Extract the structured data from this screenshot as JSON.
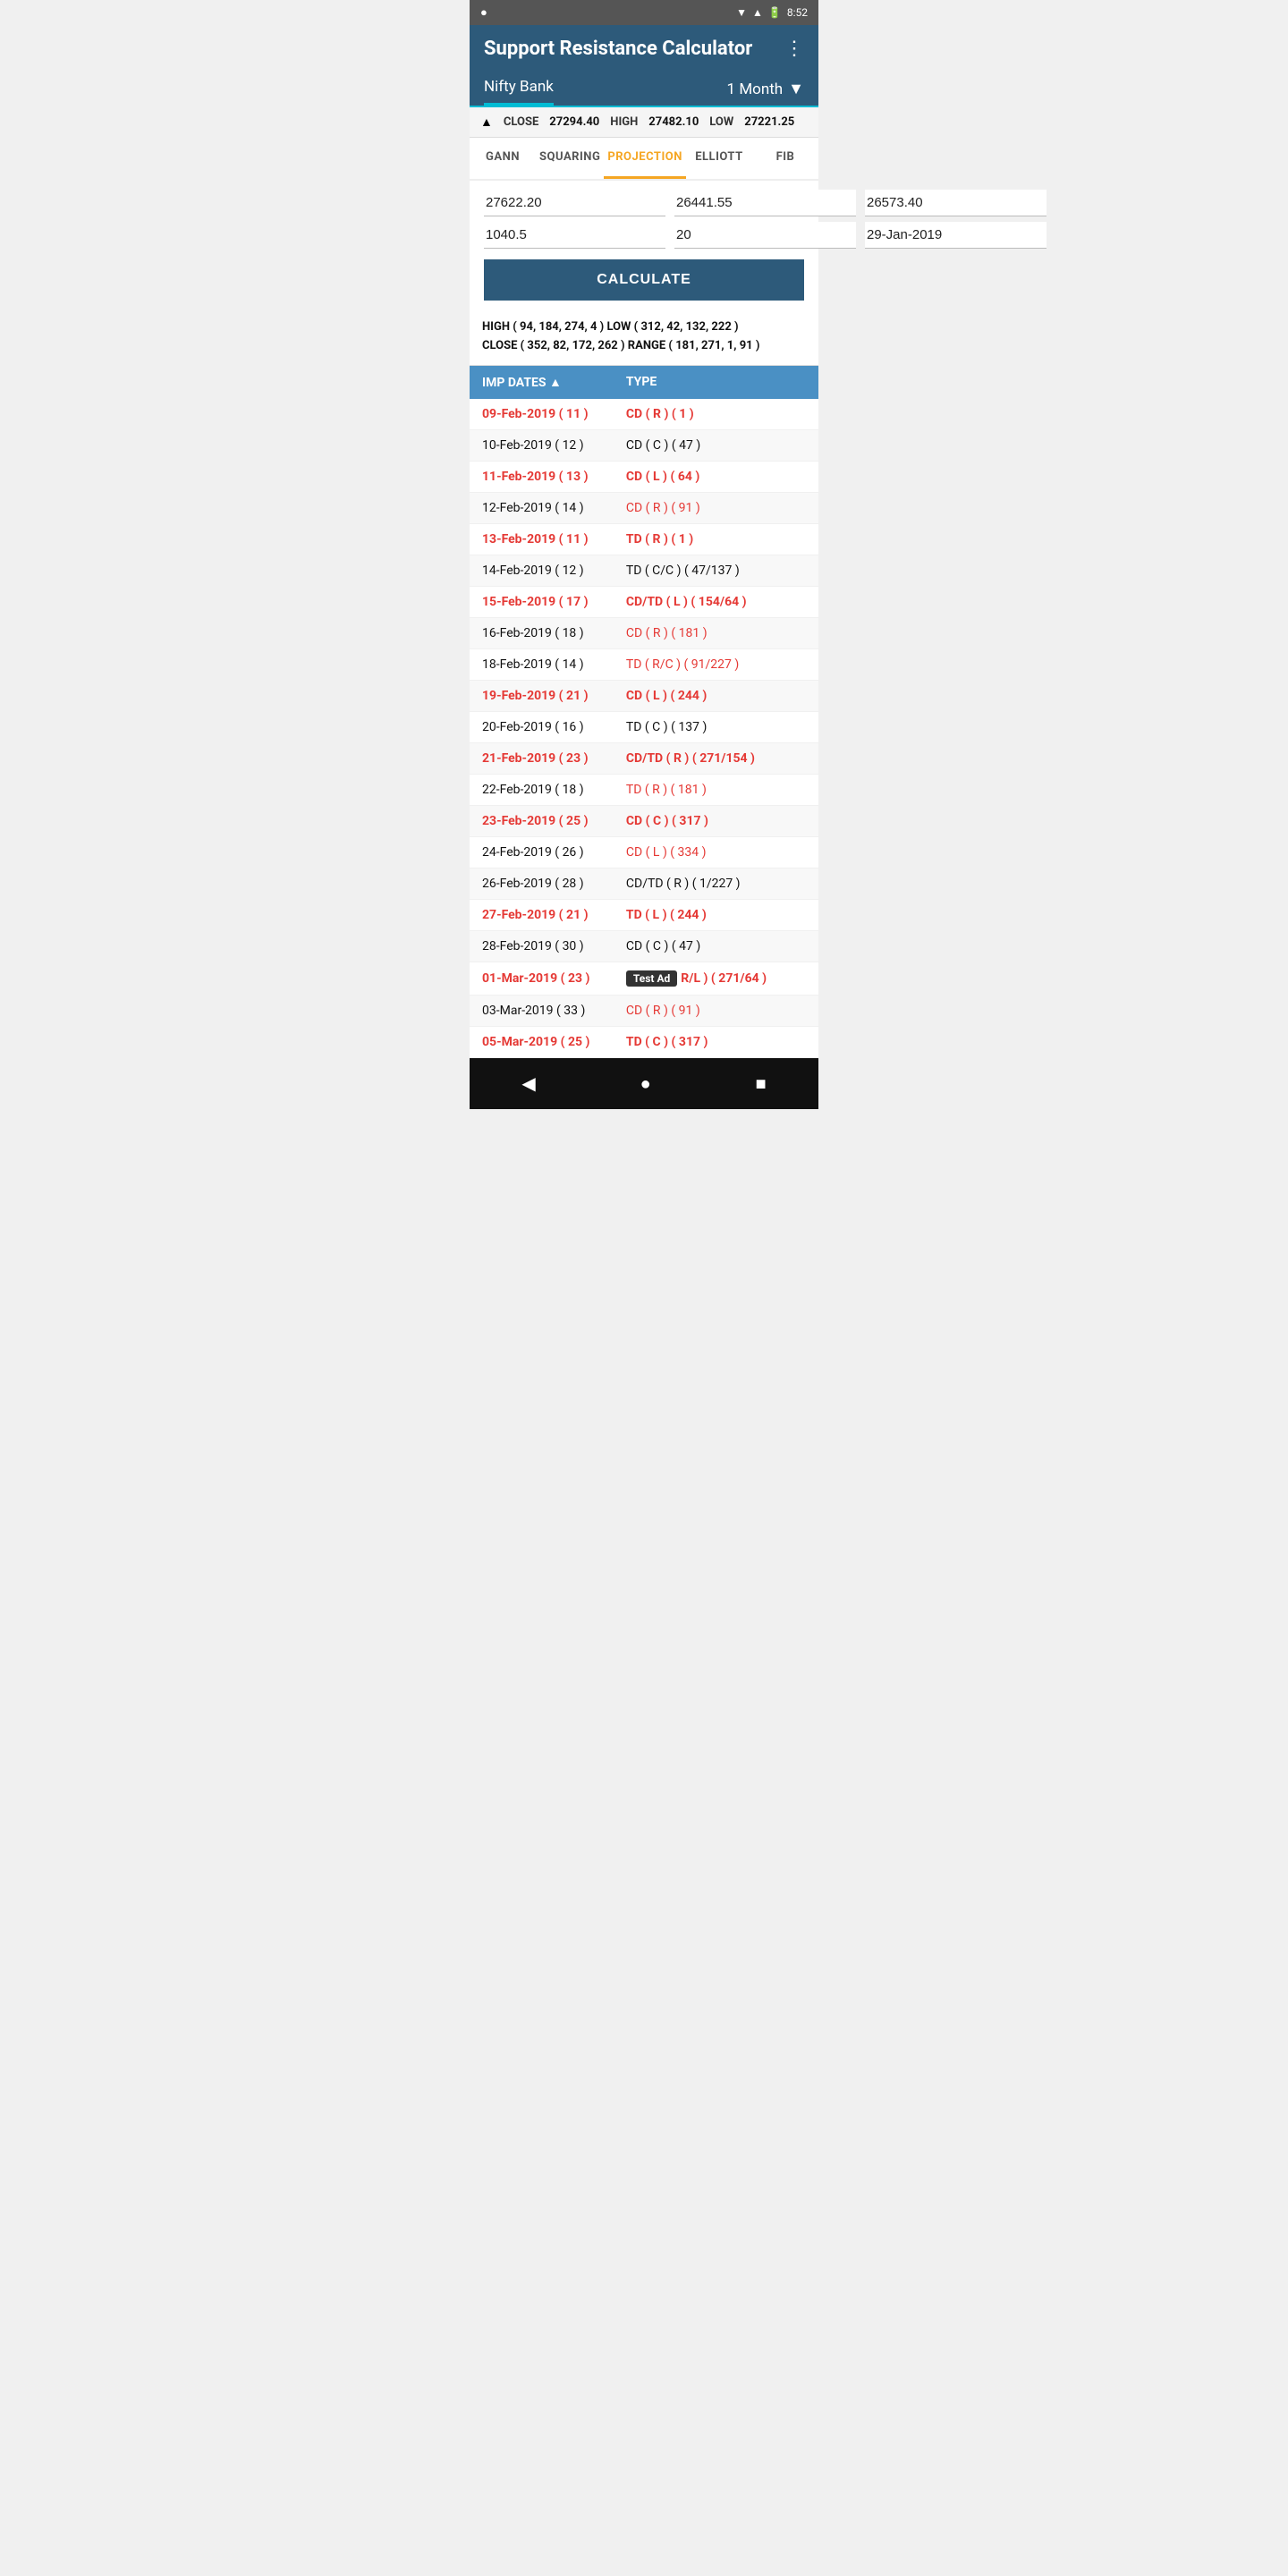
{
  "statusBar": {
    "leftIcon": "●",
    "time": "8:52",
    "icons": [
      "wifi",
      "signal",
      "battery"
    ]
  },
  "header": {
    "title": "Support Resistance Calculator",
    "menuIcon": "⋮"
  },
  "toolbar": {
    "stockName": "Nifty Bank",
    "period": "1 Month",
    "dropdownArrow": "▼"
  },
  "priceBar": {
    "arrow": "▲",
    "closeLabel": "CLOSE",
    "closeValue": "27294.40",
    "highLabel": "HIGH",
    "highValue": "27482.10",
    "lowLabel": "LOW",
    "lowValue": "27221.25"
  },
  "tabs": [
    {
      "id": "gann",
      "label": "GANN",
      "active": false
    },
    {
      "id": "squaring",
      "label": "SQUARING",
      "active": false
    },
    {
      "id": "projection",
      "label": "PROJECTION",
      "active": true
    },
    {
      "id": "elliott",
      "label": "ELLIOTT",
      "active": false
    },
    {
      "id": "fib",
      "label": "FIB",
      "active": false
    }
  ],
  "inputs": {
    "row1": [
      "27622.20",
      "26441.55",
      "26573.40"
    ],
    "row2": [
      "1040.5",
      "20",
      "29-Jan-2019"
    ]
  },
  "calculateLabel": "CALCULATE",
  "resultsHeader": {
    "line1": "HIGH ( 94, 184, 274, 4 )    LOW ( 312, 42, 132, 222 )",
    "line2": "CLOSE ( 352, 82, 172, 262 )  RANGE ( 181, 271, 1, 91 )"
  },
  "tableHeader": {
    "col1": "IMP DATES ▲",
    "col2": "TYPE"
  },
  "tableRows": [
    {
      "date": "09-Feb-2019 ( 11 )",
      "type": "CD ( R ) ( 1 )",
      "red": true
    },
    {
      "date": "10-Feb-2019 ( 12 )",
      "type": "CD ( C ) ( 47 )",
      "red": false
    },
    {
      "date": "11-Feb-2019 ( 13 )",
      "type": "CD ( L ) ( 64 )",
      "red": true
    },
    {
      "date": "12-Feb-2019 ( 14 )",
      "type": "CD ( R ) ( 91 )",
      "red": false,
      "typeRed": true
    },
    {
      "date": "13-Feb-2019 ( 11 )",
      "type": "TD ( R ) ( 1 )",
      "red": true
    },
    {
      "date": "14-Feb-2019 ( 12 )",
      "type": "TD ( C/C ) ( 47/137 )",
      "red": false
    },
    {
      "date": "15-Feb-2019 ( 17 )",
      "type": "CD/TD ( L ) ( 154/64 )",
      "red": true
    },
    {
      "date": "16-Feb-2019 ( 18 )",
      "type": "CD ( R ) ( 181 )",
      "red": false,
      "typeRed": true
    },
    {
      "date": "18-Feb-2019 ( 14 )",
      "type": "TD ( R/C ) ( 91/227 )",
      "red": false,
      "typeRed": true
    },
    {
      "date": "19-Feb-2019 ( 21 )",
      "type": "CD ( L ) ( 244 )",
      "red": true
    },
    {
      "date": "20-Feb-2019 ( 16 )",
      "type": "TD ( C ) ( 137 )",
      "red": false
    },
    {
      "date": "21-Feb-2019 ( 23 )",
      "type": "CD/TD ( R ) ( 271/154 )",
      "red": true
    },
    {
      "date": "22-Feb-2019 ( 18 )",
      "type": "TD ( R ) ( 181 )",
      "red": false,
      "typeRed": true
    },
    {
      "date": "23-Feb-2019 ( 25 )",
      "type": "CD ( C ) ( 317 )",
      "red": true
    },
    {
      "date": "24-Feb-2019 ( 26 )",
      "type": "CD ( L ) ( 334 )",
      "red": false,
      "typeRed": true
    },
    {
      "date": "26-Feb-2019 ( 28 )",
      "type": "CD/TD ( R ) ( 1/227 )",
      "red": false
    },
    {
      "date": "27-Feb-2019 ( 21 )",
      "type": "TD ( L ) ( 244 )",
      "red": true
    },
    {
      "date": "28-Feb-2019 ( 30 )",
      "type": "CD ( C ) ( 47 )",
      "red": false
    },
    {
      "date": "01-Mar-2019 ( 23 )",
      "type": "R/L ) ( 271/64 )",
      "red": true,
      "hasAd": true
    },
    {
      "date": "03-Mar-2019 ( 33 )",
      "type": "CD ( R ) ( 91 )",
      "red": false,
      "typeRed": true
    },
    {
      "date": "05-Mar-2019 ( 25 )",
      "type": "TD ( C ) ( 317 )",
      "red": true
    }
  ],
  "adLabel": "Test Ad",
  "navBar": {
    "back": "◀",
    "home": "●",
    "square": "■"
  }
}
